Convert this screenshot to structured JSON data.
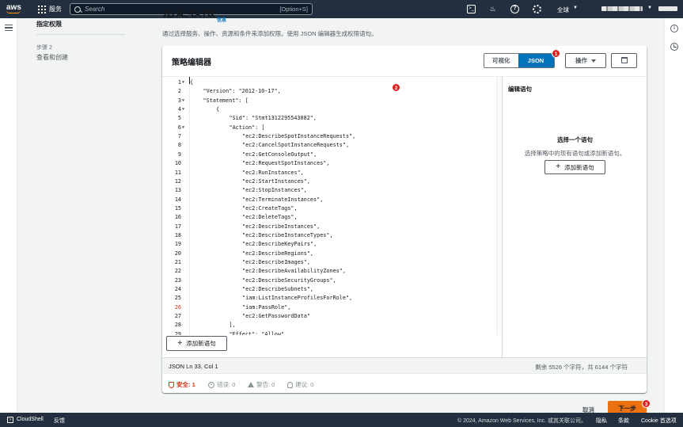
{
  "topbar": {
    "logo": "aws",
    "services_label": "服务",
    "search_placeholder": "Search",
    "search_shortcut": "[Option+S]",
    "region_label": "全球"
  },
  "step_nav": {
    "current_step": "指定权限",
    "step2_number": "步骤 2",
    "step2_label": "查看和创建"
  },
  "header": {
    "title": "指定权限",
    "info_link": "信息",
    "description": "通过选择服务、操作、资源和条件来添加权限。使用 JSON 编辑器生成权限语句。"
  },
  "policy_editor": {
    "title": "策略编辑器",
    "mode_visual": "可视化",
    "mode_json": "JSON",
    "actions_label": "操作",
    "add_statement_label": "添加新语句",
    "code_lines": [
      {
        "n": "1",
        "fold": true,
        "indent": 0,
        "text": "{"
      },
      {
        "n": "2",
        "fold": false,
        "indent": 1,
        "text": "\"Version\": \"2012-10-17\","
      },
      {
        "n": "3",
        "fold": true,
        "indent": 1,
        "text": "\"Statement\": ["
      },
      {
        "n": "4",
        "fold": true,
        "indent": 2,
        "text": "{"
      },
      {
        "n": "5",
        "fold": false,
        "indent": 3,
        "text": "\"Sid\": \"Stmt1312295543082\","
      },
      {
        "n": "6",
        "fold": true,
        "indent": 3,
        "text": "\"Action\": ["
      },
      {
        "n": "7",
        "fold": false,
        "indent": 4,
        "text": "\"ec2:DescribeSpotInstanceRequests\","
      },
      {
        "n": "8",
        "fold": false,
        "indent": 4,
        "text": "\"ec2:CancelSpotInstanceRequests\","
      },
      {
        "n": "9",
        "fold": false,
        "indent": 4,
        "text": "\"ec2:GetConsoleOutput\","
      },
      {
        "n": "10",
        "fold": false,
        "indent": 4,
        "text": "\"ec2:RequestSpotInstances\","
      },
      {
        "n": "11",
        "fold": false,
        "indent": 4,
        "text": "\"ec2:RunInstances\","
      },
      {
        "n": "12",
        "fold": false,
        "indent": 4,
        "text": "\"ec2:StartInstances\","
      },
      {
        "n": "13",
        "fold": false,
        "indent": 4,
        "text": "\"ec2:StopInstances\","
      },
      {
        "n": "14",
        "fold": false,
        "indent": 4,
        "text": "\"ec2:TerminateInstances\","
      },
      {
        "n": "15",
        "fold": false,
        "indent": 4,
        "text": "\"ec2:CreateTags\","
      },
      {
        "n": "16",
        "fold": false,
        "indent": 4,
        "text": "\"ec2:DeleteTags\","
      },
      {
        "n": "17",
        "fold": false,
        "indent": 4,
        "text": "\"ec2:DescribeInstances\","
      },
      {
        "n": "18",
        "fold": false,
        "indent": 4,
        "text": "\"ec2:DescribeInstanceTypes\","
      },
      {
        "n": "19",
        "fold": false,
        "indent": 4,
        "text": "\"ec2:DescribeKeyPairs\","
      },
      {
        "n": "20",
        "fold": false,
        "indent": 4,
        "text": "\"ec2:DescribeRegions\","
      },
      {
        "n": "21",
        "fold": false,
        "indent": 4,
        "text": "\"ec2:DescribeImages\","
      },
      {
        "n": "22",
        "fold": false,
        "indent": 4,
        "text": "\"ec2:DescribeAvailabilityZones\","
      },
      {
        "n": "23",
        "fold": false,
        "indent": 4,
        "text": "\"ec2:DescribeSecurityGroups\","
      },
      {
        "n": "24",
        "fold": false,
        "indent": 4,
        "text": "\"ec2:DescribeSubnets\","
      },
      {
        "n": "25",
        "fold": false,
        "indent": 4,
        "text": "\"iam:ListInstanceProfilesForRole\","
      },
      {
        "n": "26",
        "fold": false,
        "indent": 4,
        "text": "\"iam:PassRole\","
      },
      {
        "n": "27",
        "fold": false,
        "indent": 4,
        "text": "\"ec2:GetPasswordData\""
      },
      {
        "n": "28",
        "fold": false,
        "indent": 3,
        "text": "],"
      },
      {
        "n": "29",
        "fold": false,
        "indent": 3,
        "text": "\"Effect\": \"Allow\","
      }
    ],
    "highlight_line_color": "#d13212",
    "highlight_line": "26",
    "status_left": "JSON   Ln 33, Col 1",
    "status_right": "剩余 5526 个字符，共 6144 个字符",
    "validation": {
      "security": "安全: 1",
      "errors": "错误: 0",
      "warnings": "警告: 0",
      "suggestions": "建议: 0"
    }
  },
  "side_panel": {
    "title": "编辑语句",
    "empty_title": "选择一个语句",
    "empty_desc": "选择策略中的现有语句或添加新语句。",
    "add_label": "添加新语句"
  },
  "badges": {
    "b1": "1",
    "b2": "2",
    "b3": "3"
  },
  "footer_actions": {
    "cancel": "取消",
    "next": "下一步"
  },
  "footer": {
    "cloudshell": "CloudShell",
    "feedback": "反馈",
    "copyright": "© 2024, Amazon Web Services, Inc. 或其关联公司。",
    "privacy": "隐私",
    "terms": "条款",
    "cookie": "Cookie 首选项"
  },
  "colors": {
    "nav_bg": "#232f3e",
    "primary_blue": "#0073bb",
    "next_orange": "#ec7211",
    "badge_red": "#e02020"
  }
}
